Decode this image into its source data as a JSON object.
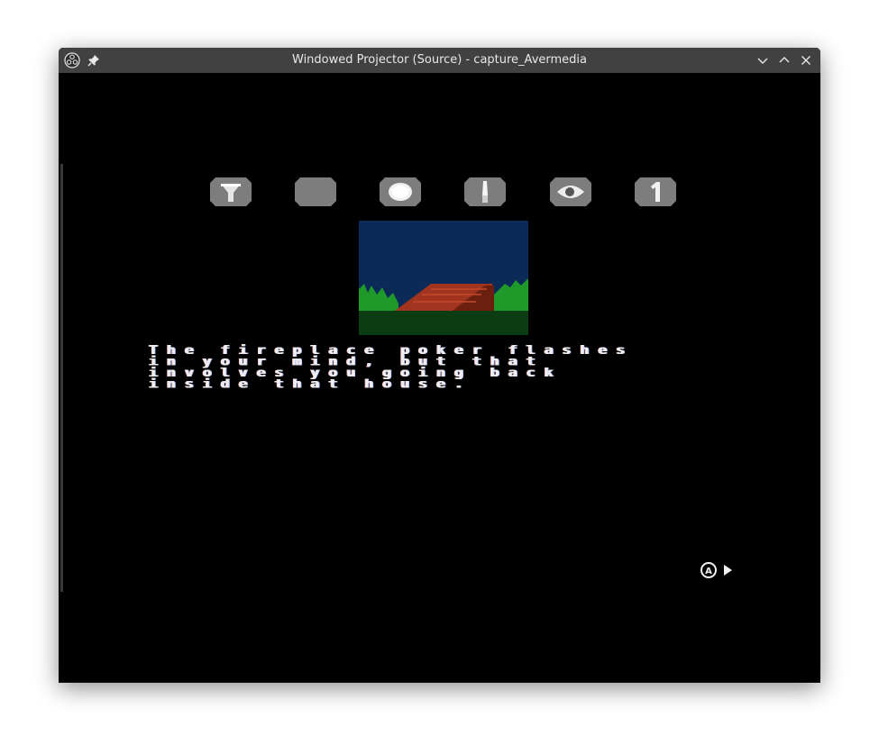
{
  "window": {
    "title": "Windowed Projector (Source) - capture_Avermedia"
  },
  "icons": {
    "app": "obs-icon",
    "pin": "pin-icon",
    "minimize": "chevron-down-icon",
    "maximize": "chevron-up-icon",
    "close": "close-icon"
  },
  "inventory": {
    "items": [
      {
        "name": "funnel-item-icon"
      },
      {
        "name": "empty-item-slot"
      },
      {
        "name": "round-item-icon"
      },
      {
        "name": "knife-item-icon"
      },
      {
        "name": "eye-item-icon"
      },
      {
        "name": "number-item-icon",
        "label": "1"
      }
    ]
  },
  "story": {
    "lines": [
      "The fireplace poker flashes",
      "in your mind, but that",
      "involves you going back",
      "inside that house."
    ]
  },
  "prompt": {
    "button": "A",
    "icon": "play-arrow-icon"
  },
  "colors": {
    "sky": "#0b2a57",
    "roof": "#a0341e",
    "trees": "#1f9a2a",
    "ground": "#0c3d12",
    "slot": "#7d7d7d"
  }
}
